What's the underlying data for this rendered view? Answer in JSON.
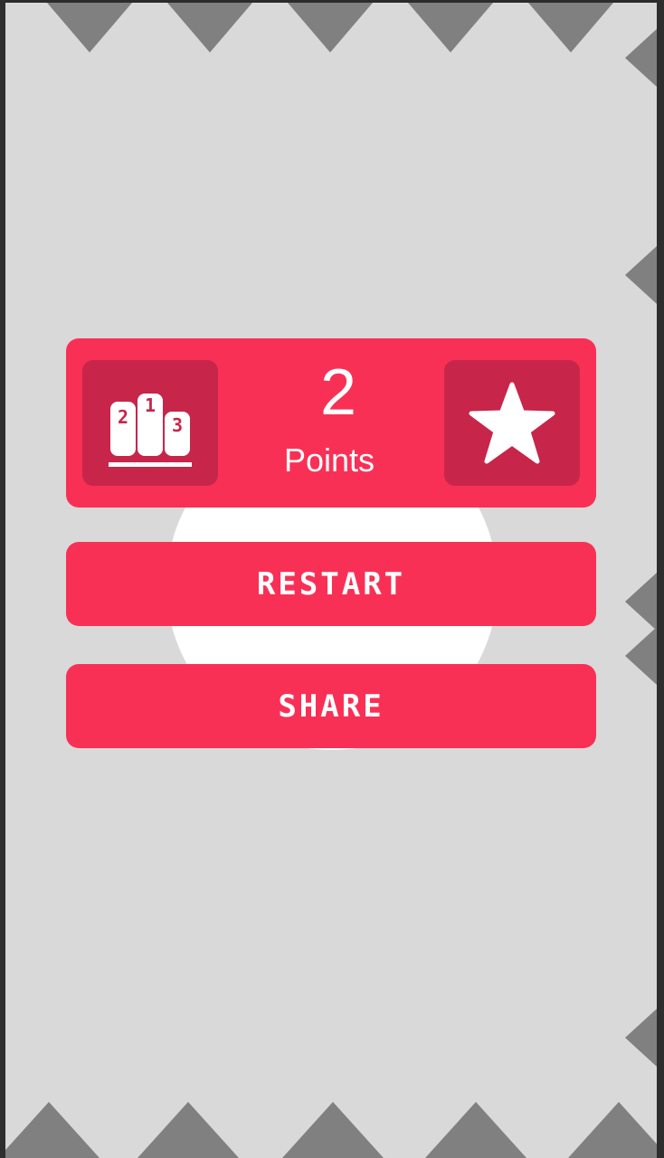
{
  "score": {
    "value": "2",
    "label": "Points"
  },
  "buttons": {
    "restart_label": "RESTART",
    "share_label": "SHARE"
  },
  "icons": {
    "leaderboard": "podium-icon",
    "rate": "star-icon"
  },
  "colors": {
    "background": "#d9d9d9",
    "spike": "#808080",
    "accent": "#f93055",
    "accent_dark": "#c8254a",
    "text": "#ffffff"
  }
}
